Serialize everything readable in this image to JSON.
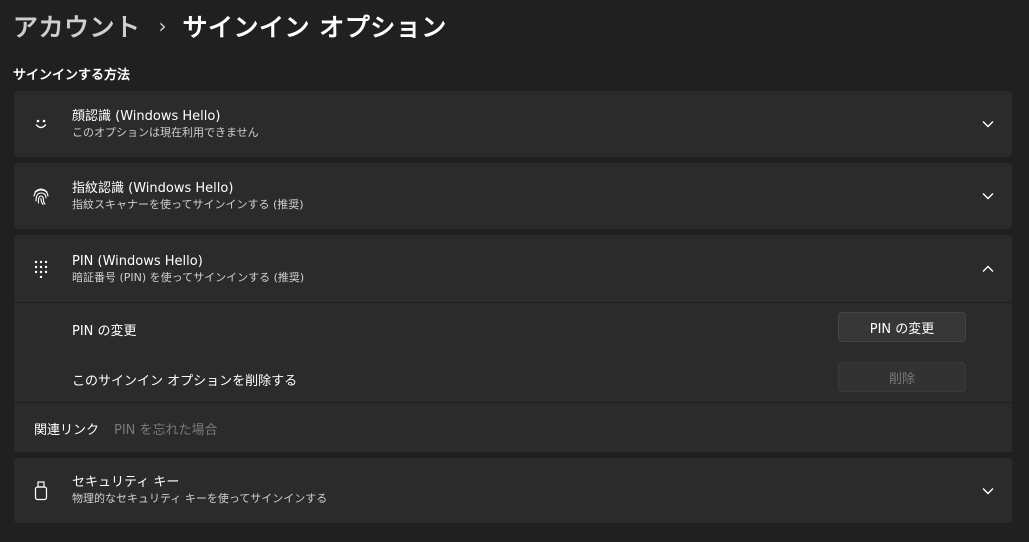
{
  "breadcrumb": {
    "parent": "アカウント",
    "separator": "›",
    "current": "サインイン オプション"
  },
  "section_title": "サインインする方法",
  "methods": [
    {
      "icon": "smiley-face-icon",
      "title": "顔認識 (Windows Hello)",
      "subtitle": "このオプションは現在利用できません",
      "expanded": false
    },
    {
      "icon": "fingerprint-icon",
      "title": "指紋認識 (Windows Hello)",
      "subtitle": "指紋スキャナーを使ってサインインする (推奨)",
      "expanded": false
    },
    {
      "icon": "pin-keypad-icon",
      "title": "PIN (Windows Hello)",
      "subtitle": "暗証番号 (PIN) を使ってサインインする (推奨)",
      "expanded": true
    },
    {
      "icon": "usb-security-key-icon",
      "title": "セキュリティ キー",
      "subtitle": "物理的なセキュリティ キーを使ってサインインする",
      "expanded": false
    }
  ],
  "pin_panel": {
    "change_label": "PIN の変更",
    "change_button": "PIN の変更",
    "remove_label": "このサインイン オプションを削除する",
    "remove_button": "削除",
    "remove_button_enabled": false,
    "related_label": "関連リンク",
    "related_link": "PIN を忘れた場合"
  },
  "colors": {
    "background": "#202020",
    "card": "#2b2b2b",
    "text": "#ffffff",
    "muted_text": "#7a7a7a"
  }
}
